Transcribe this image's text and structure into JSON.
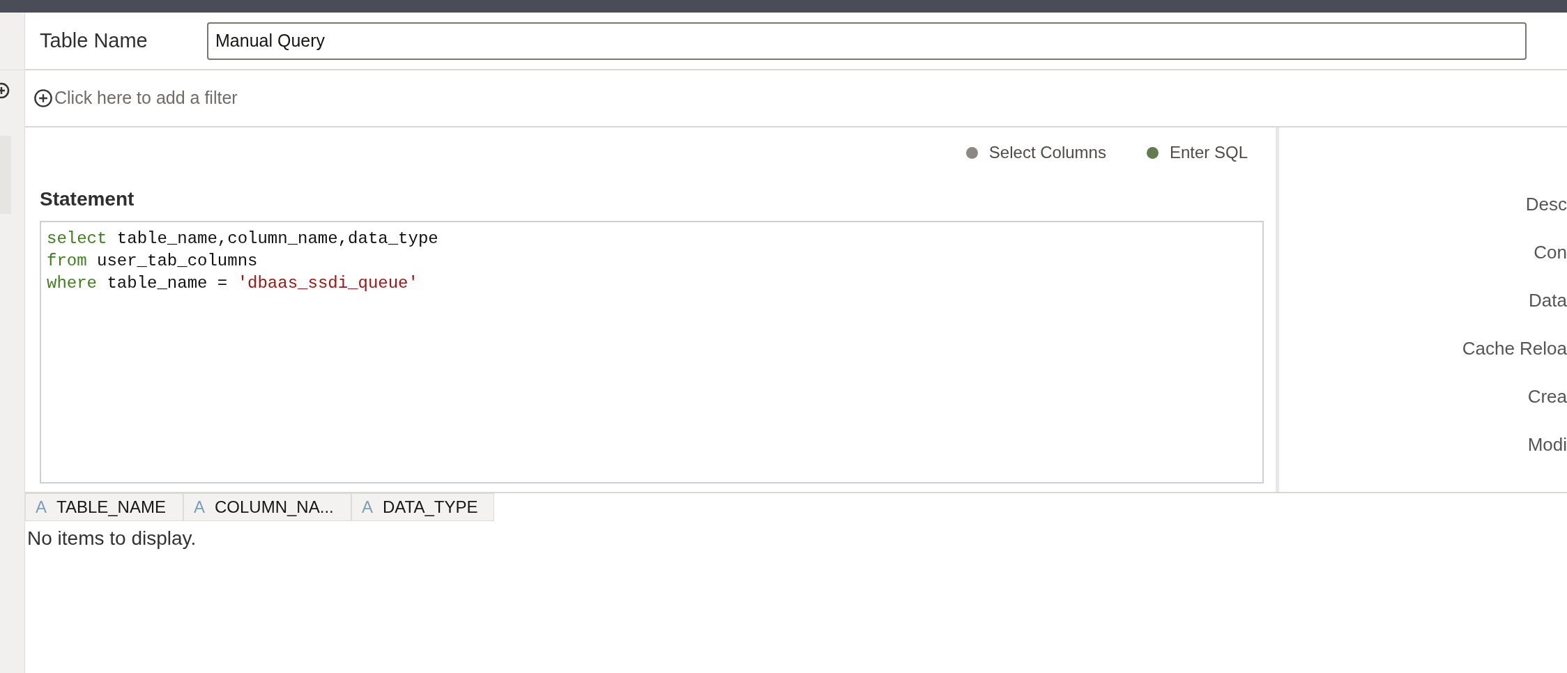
{
  "table_name": {
    "label": "Table Name",
    "value": "Manual Query"
  },
  "filter": {
    "label": "Click here to add a filter"
  },
  "mode_options": [
    {
      "label": "Select Columns",
      "selected": false
    },
    {
      "label": "Enter SQL",
      "selected": true
    }
  ],
  "statement": {
    "label": "Statement",
    "lines": [
      [
        {
          "kind": "keyword",
          "text": "select"
        },
        {
          "kind": "plain",
          "text": " table_name,column_name,data_type"
        }
      ],
      [
        {
          "kind": "keyword",
          "text": "from"
        },
        {
          "kind": "plain",
          "text": " user_tab_columns"
        }
      ],
      [
        {
          "kind": "keyword",
          "text": "where"
        },
        {
          "kind": "plain",
          "text": " table_name = "
        },
        {
          "kind": "string",
          "text": "'dbaas_ssdi_queue'"
        }
      ]
    ]
  },
  "properties": [
    "Desc",
    "Con",
    "Data",
    "Cache Reloa",
    "Crea",
    "Modi"
  ],
  "results": {
    "columns": [
      {
        "type_glyph": "A",
        "title": "TABLE_NAME"
      },
      {
        "type_glyph": "A",
        "title": "COLUMN_NA..."
      },
      {
        "type_glyph": "A",
        "title": "DATA_TYPE"
      }
    ],
    "empty_message": "No items to display."
  }
}
